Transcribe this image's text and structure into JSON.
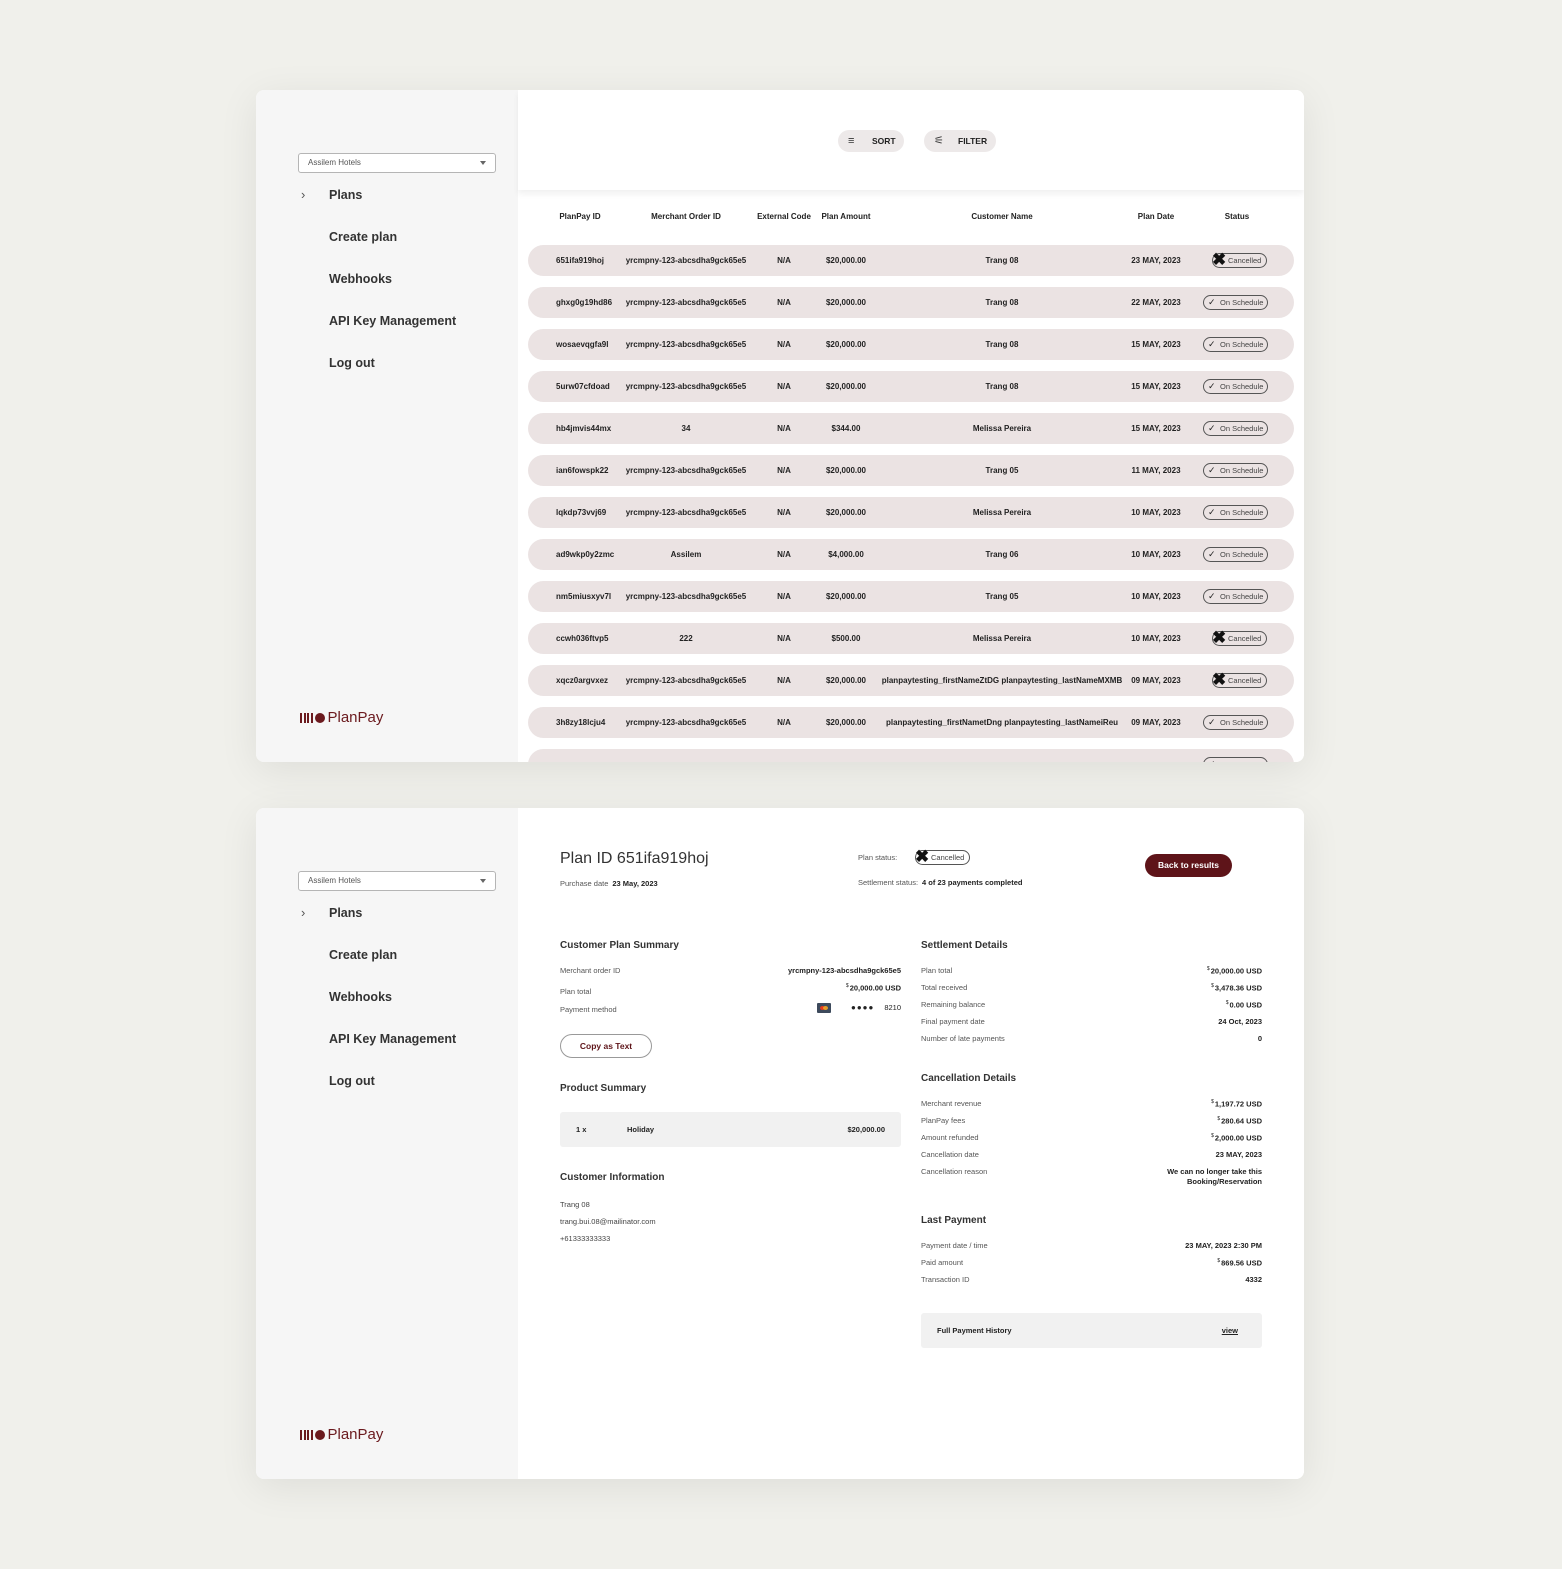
{
  "brand": {
    "name": "PlanPay",
    "color": "#6b1a1e",
    "accent_dark": "#5e1419"
  },
  "sidebar": {
    "org_select": {
      "value": "Assilem Hotels"
    },
    "items": [
      {
        "label": "Plans",
        "expandable": true
      },
      {
        "label": "Create plan"
      },
      {
        "label": "Webhooks"
      },
      {
        "label": "API Key Management"
      },
      {
        "label": "Log out"
      }
    ]
  },
  "list_view": {
    "toolbar": {
      "sort_label": "SORT",
      "filter_label": "FILTER"
    },
    "columns": [
      "PlanPay ID",
      "Merchant Order ID",
      "External Code",
      "Plan Amount",
      "Customer Name",
      "Plan Date",
      "Status"
    ],
    "rows": [
      {
        "id": "651ifa919hoj",
        "merchant_order_id": "yrcmpny-123-abcsdha9gck65e5",
        "external_code": "N/A",
        "amount": "$20,000.00",
        "customer": "Trang 08",
        "date": "23 MAY, 2023",
        "status": "Cancelled"
      },
      {
        "id": "ghxg0g19hd86",
        "merchant_order_id": "yrcmpny-123-abcsdha9gck65e5",
        "external_code": "N/A",
        "amount": "$20,000.00",
        "customer": "Trang 08",
        "date": "22 MAY, 2023",
        "status": "On Schedule"
      },
      {
        "id": "wosaevqgfa9l",
        "merchant_order_id": "yrcmpny-123-abcsdha9gck65e5",
        "external_code": "N/A",
        "amount": "$20,000.00",
        "customer": "Trang 08",
        "date": "15 MAY, 2023",
        "status": "On Schedule"
      },
      {
        "id": "5urw07cfdoad",
        "merchant_order_id": "yrcmpny-123-abcsdha9gck65e5",
        "external_code": "N/A",
        "amount": "$20,000.00",
        "customer": "Trang 08",
        "date": "15 MAY, 2023",
        "status": "On Schedule"
      },
      {
        "id": "hb4jmvis44mx",
        "merchant_order_id": "34",
        "external_code": "N/A",
        "amount": "$344.00",
        "customer": "Melissa Pereira",
        "date": "15 MAY, 2023",
        "status": "On Schedule"
      },
      {
        "id": "ian6fowspk22",
        "merchant_order_id": "yrcmpny-123-abcsdha9gck65e5",
        "external_code": "N/A",
        "amount": "$20,000.00",
        "customer": "Trang 05",
        "date": "11 MAY, 2023",
        "status": "On Schedule"
      },
      {
        "id": "lqkdp73vvj69",
        "merchant_order_id": "yrcmpny-123-abcsdha9gck65e5",
        "external_code": "N/A",
        "amount": "$20,000.00",
        "customer": "Melissa Pereira",
        "date": "10 MAY, 2023",
        "status": "On Schedule"
      },
      {
        "id": "ad9wkp0y2zmc",
        "merchant_order_id": "Assilem",
        "external_code": "N/A",
        "amount": "$4,000.00",
        "customer": "Trang 06",
        "date": "10 MAY, 2023",
        "status": "On Schedule"
      },
      {
        "id": "nm5miusxyv7l",
        "merchant_order_id": "yrcmpny-123-abcsdha9gck65e5",
        "external_code": "N/A",
        "amount": "$20,000.00",
        "customer": "Trang 05",
        "date": "10 MAY, 2023",
        "status": "On Schedule"
      },
      {
        "id": "ccwh036ftvp5",
        "merchant_order_id": "222",
        "external_code": "N/A",
        "amount": "$500.00",
        "customer": "Melissa Pereira",
        "date": "10 MAY, 2023",
        "status": "Cancelled"
      },
      {
        "id": "xqcz0argvxez",
        "merchant_order_id": "yrcmpny-123-abcsdha9gck65e5",
        "external_code": "N/A",
        "amount": "$20,000.00",
        "customer": "planpaytesting_firstNameZtDG planpaytesting_lastNameMXMB",
        "date": "09 MAY, 2023",
        "status": "Cancelled"
      },
      {
        "id": "3h8zy18lcju4",
        "merchant_order_id": "yrcmpny-123-abcsdha9gck65e5",
        "external_code": "N/A",
        "amount": "$20,000.00",
        "customer": "planpaytesting_firstNametDng planpaytesting_lastNameiReu",
        "date": "09 MAY, 2023",
        "status": "On Schedule"
      },
      {
        "id": "",
        "merchant_order_id": "",
        "external_code": "",
        "amount": "",
        "customer": "",
        "date": "",
        "status": "On Schedule",
        "partial": true
      }
    ]
  },
  "detail_view": {
    "plan_id_prefix": "Plan ID",
    "plan_id": "651ifa919hoj",
    "title": "Plan ID 651ifa919hoj",
    "purchase_date_label": "Purchase date",
    "purchase_date": "23 May, 2023",
    "plan_status_label": "Plan status:",
    "plan_status": "Cancelled",
    "settlement_status_label": "Settlement status:",
    "settlement_status": "4 of 23 payments completed",
    "back_button": "Back to results",
    "customer_plan_summary": {
      "title": "Customer Plan Summary",
      "merchant_order_id_label": "Merchant order ID",
      "merchant_order_id": "yrcmpny-123-abcsdha9gck65e5",
      "plan_total_label": "Plan total",
      "plan_total_currency": "$",
      "plan_total": "20,000.00 USD",
      "payment_method_label": "Payment method",
      "payment_method_icon": "mastercard-icon",
      "payment_method_mask": "●●●●",
      "payment_method_last4": "8210",
      "copy_button": "Copy as Text"
    },
    "product_summary": {
      "title": "Product Summary",
      "items": [
        {
          "qty": "1 x",
          "name": "Holiday",
          "price": "$20,000.00"
        }
      ]
    },
    "customer_information": {
      "title": "Customer Information",
      "name": "Trang 08",
      "email": "trang.bui.08@mailinator.com",
      "phone": "+61333333333"
    },
    "settlement_details": {
      "title": "Settlement Details",
      "rows": [
        {
          "label": "Plan total",
          "currency": "$",
          "value": "20,000.00 USD"
        },
        {
          "label": "Total received",
          "currency": "$",
          "value": "3,478.36 USD"
        },
        {
          "label": "Remaining balance",
          "currency": "$",
          "value": "0.00 USD"
        },
        {
          "label": "Final payment date",
          "currency": "",
          "value": "24 Oct, 2023"
        },
        {
          "label": "Number of late payments",
          "currency": "",
          "value": "0"
        }
      ]
    },
    "cancellation_details": {
      "title": "Cancellation Details",
      "rows": [
        {
          "label": "Merchant revenue",
          "currency": "$",
          "value": "1,197.72 USD"
        },
        {
          "label": "PlanPay fees",
          "currency": "$",
          "value": "280.64 USD"
        },
        {
          "label": "Amount refunded",
          "currency": "$",
          "value": "2,000.00 USD"
        },
        {
          "label": "Cancellation date",
          "currency": "",
          "value": "23 MAY, 2023"
        },
        {
          "label": "Cancellation reason",
          "currency": "",
          "value": "We can no longer take this Booking/Reservation"
        }
      ]
    },
    "last_payment": {
      "title": "Last Payment",
      "rows": [
        {
          "label": "Payment date / time",
          "currency": "",
          "value": "23 MAY, 2023 2:30 PM"
        },
        {
          "label": "Paid amount",
          "currency": "$",
          "value": "869.56 USD"
        },
        {
          "label": "Transaction ID",
          "currency": "",
          "value": "4332"
        }
      ]
    },
    "full_payment_history": {
      "label": "Full Payment History",
      "link": "view"
    }
  }
}
